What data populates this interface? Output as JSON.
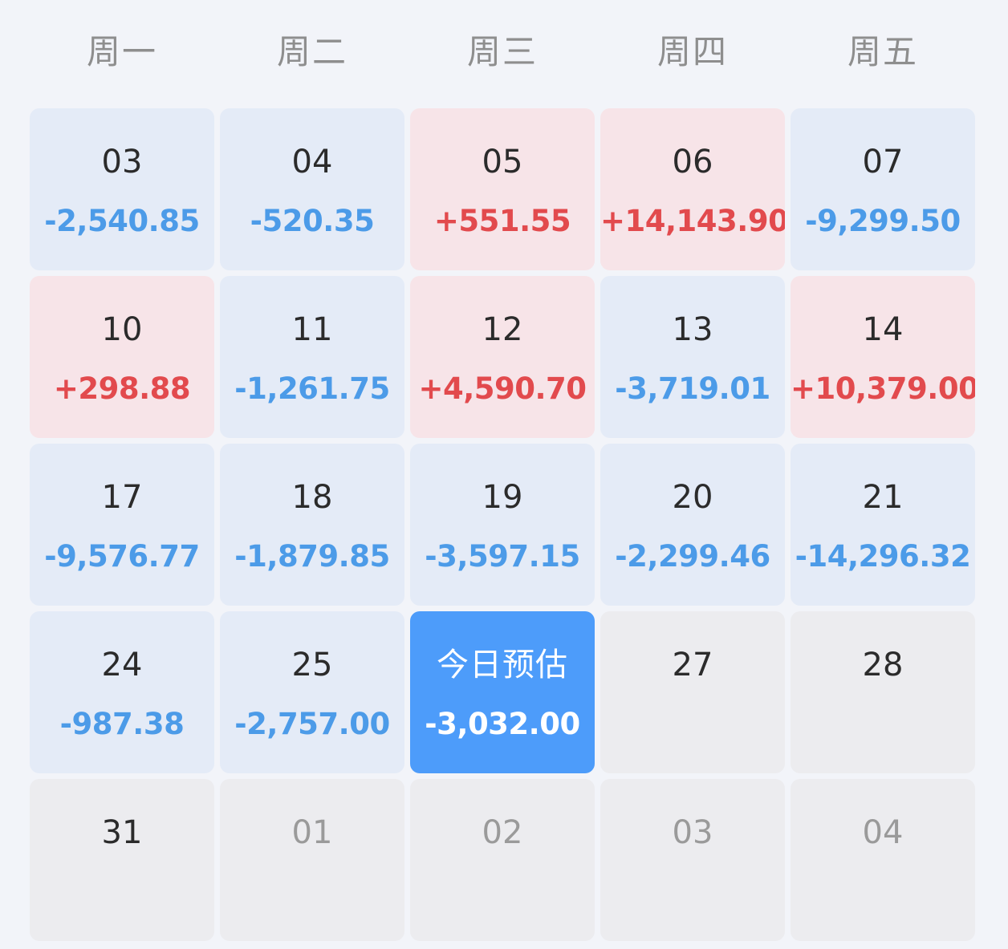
{
  "weekdays": [
    "周一",
    "周二",
    "周三",
    "周四",
    "周五"
  ],
  "colors": {
    "background": "#f2f4f9",
    "loss_bg": "#e4ebf7",
    "gain_bg": "#f7e4e8",
    "empty_bg": "#ececef",
    "today_bg": "#4d9cfa",
    "loss_text": "#4c9be8",
    "gain_text": "#e24a4d"
  },
  "days": [
    {
      "day": "03",
      "amount": "-2,540.85",
      "status": "loss"
    },
    {
      "day": "04",
      "amount": "-520.35",
      "status": "loss"
    },
    {
      "day": "05",
      "amount": "+551.55",
      "status": "gain"
    },
    {
      "day": "06",
      "amount": "+14,143.90",
      "status": "gain"
    },
    {
      "day": "07",
      "amount": "-9,299.50",
      "status": "loss"
    },
    {
      "day": "10",
      "amount": "+298.88",
      "status": "gain"
    },
    {
      "day": "11",
      "amount": "-1,261.75",
      "status": "loss"
    },
    {
      "day": "12",
      "amount": "+4,590.70",
      "status": "gain"
    },
    {
      "day": "13",
      "amount": "-3,719.01",
      "status": "loss"
    },
    {
      "day": "14",
      "amount": "+10,379.00",
      "status": "gain"
    },
    {
      "day": "17",
      "amount": "-9,576.77",
      "status": "loss"
    },
    {
      "day": "18",
      "amount": "-1,879.85",
      "status": "loss"
    },
    {
      "day": "19",
      "amount": "-3,597.15",
      "status": "loss"
    },
    {
      "day": "20",
      "amount": "-2,299.46",
      "status": "loss"
    },
    {
      "day": "21",
      "amount": "-14,296.32",
      "status": "loss"
    },
    {
      "day": "24",
      "amount": "-987.38",
      "status": "loss"
    },
    {
      "day": "25",
      "amount": "-2,757.00",
      "status": "loss"
    },
    {
      "day": "今日预估",
      "amount": "-3,032.00",
      "status": "today"
    },
    {
      "day": "27",
      "amount": "",
      "status": "empty"
    },
    {
      "day": "28",
      "amount": "",
      "status": "empty"
    },
    {
      "day": "31",
      "amount": "",
      "status": "empty"
    },
    {
      "day": "01",
      "amount": "",
      "status": "future"
    },
    {
      "day": "02",
      "amount": "",
      "status": "future"
    },
    {
      "day": "03",
      "amount": "",
      "status": "future"
    },
    {
      "day": "04",
      "amount": "",
      "status": "future"
    }
  ]
}
